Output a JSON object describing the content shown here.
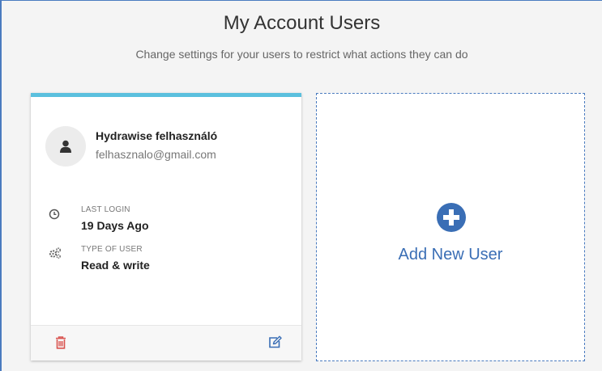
{
  "header": {
    "title": "My Account Users",
    "subtitle": "Change settings for your users to restrict what actions they can do"
  },
  "user_card": {
    "accent_color": "#5bc0de",
    "name": "Hydrawise felhasználó",
    "email": "felhasznalo@gmail.com",
    "avatar_icon": "user-icon",
    "last_login": {
      "icon": "clock-icon",
      "label": "LAST LOGIN",
      "value": "19 Days Ago"
    },
    "user_type": {
      "icon": "gears-icon",
      "label": "TYPE OF USER",
      "value": "Read & write"
    },
    "footer": {
      "delete_icon": "trash-icon",
      "delete_color": "#d9534f",
      "edit_icon": "edit-icon",
      "edit_color": "#3a6eb5"
    }
  },
  "add_user": {
    "icon": "plus-circle-icon",
    "label": "Add New User",
    "color": "#3a6eb5"
  }
}
